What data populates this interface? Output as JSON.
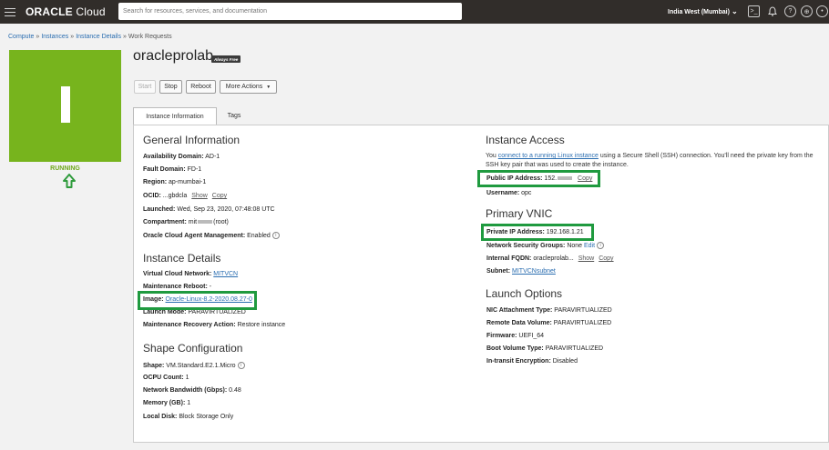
{
  "topbar": {
    "logo_oracle": "ORACLE",
    "logo_cloud": "Cloud",
    "search_placeholder": "Search for resources, services, and documentation",
    "region": "India West (Mumbai)"
  },
  "breadcrumb": [
    "Compute",
    "Instances",
    "Instance Details",
    "Work Requests"
  ],
  "instance": {
    "name": "oracleprolab",
    "badge": "Always Free",
    "status": "RUNNING"
  },
  "actions": {
    "start": "Start",
    "stop": "Stop",
    "reboot": "Reboot",
    "more": "More Actions"
  },
  "tabs": [
    "Instance Information",
    "Tags"
  ],
  "general": {
    "heading": "General Information",
    "availability_domain_label": "Availability Domain:",
    "availability_domain": "AD-1",
    "fault_domain_label": "Fault Domain:",
    "fault_domain": "FD-1",
    "region_label": "Region:",
    "region": "ap-mumbai-1",
    "ocid_label": "OCID:",
    "ocid": "...gbdcla",
    "show": "Show",
    "copy": "Copy",
    "launched_label": "Launched:",
    "launched": "Wed, Sep 23, 2020, 07:48:08 UTC",
    "compartment_label": "Compartment:",
    "compartment_prefix": "mit",
    "compartment_suffix": "(root)",
    "agent_label": "Oracle Cloud Agent Management:",
    "agent": "Enabled"
  },
  "details": {
    "heading": "Instance Details",
    "vcn_label": "Virtual Cloud Network:",
    "vcn": "MITVCN",
    "maint_reboot_label": "Maintenance Reboot:",
    "maint_reboot": "-",
    "image_label": "Image:",
    "image": "Oracle-Linux-8.2-2020.08.27-0",
    "launch_mode_label": "Launch Mode:",
    "launch_mode": "PARAVIRTUALIZED",
    "recovery_label": "Maintenance Recovery Action:",
    "recovery": "Restore instance"
  },
  "shape": {
    "heading": "Shape Configuration",
    "shape_label": "Shape:",
    "shape": "VM.Standard.E2.1.Micro",
    "ocpu_label": "OCPU Count:",
    "ocpu": "1",
    "bandwidth_label": "Network Bandwidth (Gbps):",
    "bandwidth": "0.48",
    "memory_label": "Memory (GB):",
    "memory": "1",
    "disk_label": "Local Disk:",
    "disk": "Block Storage Only"
  },
  "access": {
    "heading": "Instance Access",
    "text_before": "You ",
    "link": "connect to a running Linux instance",
    "text_after": " using a Secure Shell (SSH) connection. You'll need the private key from the SSH key pair that was used to create the instance.",
    "public_ip_label": "Public IP Address:",
    "public_ip": "152.",
    "copy": "Copy",
    "username_label": "Username:",
    "username": "opc"
  },
  "vnic": {
    "heading": "Primary VNIC",
    "private_ip_label": "Private IP Address:",
    "private_ip": "192.168.1.21",
    "nsg_label": "Network Security Groups:",
    "nsg": "None",
    "edit": "Edit",
    "fqdn_label": "Internal FQDN:",
    "fqdn": "oracleprolab...",
    "show": "Show",
    "copy": "Copy",
    "subnet_label": "Subnet:",
    "subnet": "MITVCNsubnet"
  },
  "launch": {
    "heading": "Launch Options",
    "nic_label": "NIC Attachment Type:",
    "nic": "PARAVIRTUALIZED",
    "remote_label": "Remote Data Volume:",
    "remote": "PARAVIRTUALIZED",
    "firmware_label": "Firmware:",
    "firmware": "UEFI_64",
    "boot_label": "Boot Volume Type:",
    "boot": "PARAVIRTUALIZED",
    "transit_label": "In-transit Encryption:",
    "transit": "Disabled"
  },
  "colors": {
    "topbar": "#312d2a",
    "status_green": "#77b41d",
    "highlight": "#1f9a3f",
    "link": "#2a6db0"
  }
}
